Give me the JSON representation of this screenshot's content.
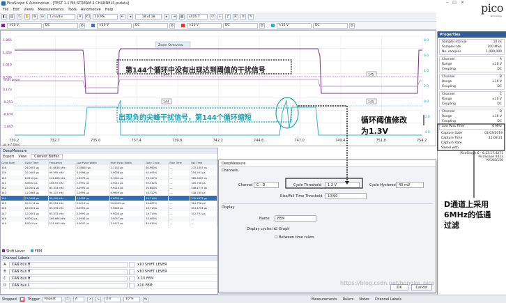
{
  "window": {
    "title": "PicoScope 6 Automotive - [TEST 1.1 MS STREAM 4 CHANNELS.psdata]",
    "controls": [
      "–",
      "□",
      "×"
    ]
  },
  "logo": {
    "text": "pico",
    "sub": "Technology"
  },
  "menu": [
    "File",
    "Edit",
    "Views",
    "Measurements",
    "Tools",
    "Automotive",
    "Help"
  ],
  "toolbar1": {
    "timebase": "1 ms/div",
    "samples": "10 MS",
    "page": "18 of 18",
    "zoom": "x416.7"
  },
  "toolbar2": {
    "channels": [
      {
        "range": "±10 V",
        "coupling": "DC",
        "color": "#7a2c8c"
      },
      {
        "range": "±10 V",
        "coupling": "DC",
        "color": "#3b6fcf"
      },
      {
        "range": "±10 V",
        "coupling": "DC",
        "color": "#d43c3c"
      },
      {
        "range": "±10 V",
        "coupling": "DC",
        "color": "#2bb5c4"
      }
    ]
  },
  "scope": {
    "y_labels_left": [
      "1.866",
      "1.443",
      "1.019",
      "0.596",
      "0.173",
      "-0.251",
      "-0.674",
      "-1.097"
    ],
    "y_labels_right": [
      "8.0",
      "6.0",
      "4.0",
      "2.0",
      "0.0",
      "-2.0",
      "-4.0"
    ],
    "x_ticks": [
      "730.2",
      "732.7",
      "735.0",
      "737.4",
      "739.8",
      "742.2",
      "744.6",
      "747.0",
      "749.4",
      "751.8",
      "754.2"
    ],
    "x_unit_left": "μs",
    "x_offset": "+7.0ms",
    "shift_lever": "Shift Lever",
    "fem_label": "FEM",
    "zoom_overview": "Zoom Overview",
    "markers": [
      "144",
      "145",
      "144",
      "145"
    ],
    "annotation1": "第144个循环中没有出现达到阈值的干扰信号",
    "annotation2": "出现负的尖峰干扰信号，第144个循环缩短"
  },
  "annotations": {
    "threshold": "循环阈值修改\n为1.3V",
    "lowpass": "D通道上采用\n6MHz的低通\n过滤",
    "watermark": "https://blog.csdn.net/hongke_pico"
  },
  "properties": {
    "title": "Properties",
    "general": [
      [
        "Sample interval",
        "10 ns"
      ],
      [
        "Sample rate",
        "100 MS/s"
      ],
      [
        "No. samples",
        "1,000,000"
      ]
    ],
    "channels": [
      {
        "rows": [
          [
            "Channel",
            "A"
          ],
          [
            "Range",
            "±10 V"
          ],
          [
            "Coupling",
            "DC"
          ]
        ]
      },
      {
        "rows": [
          [
            "Channel",
            "B"
          ],
          [
            "Range",
            "±10 V"
          ],
          [
            "Coupling",
            "DC"
          ]
        ]
      },
      {
        "rows": [
          [
            "Channel",
            "C"
          ],
          [
            "Range",
            "±10 V"
          ],
          [
            "Coupling",
            "DC"
          ]
        ]
      },
      {
        "rows": [
          [
            "Channel",
            "D"
          ],
          [
            "Range",
            "±10 V"
          ],
          [
            "Coupling",
            "DC"
          ],
          [
            "Low Pass Filter",
            "6 MHz"
          ]
        ]
      }
    ],
    "capture": [
      [
        "Capture Date",
        "01/03/2019"
      ],
      [
        "Capture Time",
        "12:08:21"
      ],
      [
        "Capture Rate",
        ""
      ],
      [
        "Saved with",
        ""
      ]
    ],
    "version": [
      "PicoScope 6 - 6.13.17.4271",
      "PicoScope 4423",
      "AV105/150"
    ]
  },
  "deepmeasure": {
    "title": "DeepMeasure",
    "tools": [
      "Export",
      "View",
      "Current Buffer"
    ],
    "columns": [
      "Cycle Num",
      "Cycle Time",
      "Frequency",
      "Low Pulse Width",
      "High Pulse Width",
      "Duty Cycle",
      "Rise Time",
      "Fall Time"
    ],
    "rows": [
      [
        "138",
        "24.0007 μs",
        "41.6616 kHz",
        "21.8805 μs",
        "2.1152 μs",
        "80.960%",
        "---",
        "272.1457 ns"
      ],
      [
        "139",
        "10.0005 μs",
        "99.995 kHz",
        "4.0998 μs",
        "5.9008 μs",
        "40.095%",
        "---",
        "254.591 μs"
      ],
      [
        "140",
        "8.0110 μs",
        "124.828 kHz",
        "1.4979 μs",
        "5.1001 μs",
        "75.147%",
        "---",
        "385.4629 ns"
      ],
      [
        "141",
        "6.0002 μs",
        "166.59 kHz",
        "2.0991 μs",
        "3.9011 μs",
        "50.332%",
        "---",
        "300.758 μs"
      ],
      [
        "142",
        "12.0001 μs",
        "83.333 kHz",
        "2.0991 μs",
        "9.9010 μs",
        "20.863%",
        "---",
        "548.4775 μs"
      ],
      [
        "143",
        "11.0664 μs",
        "90.337 kHz",
        "2.0993 μs",
        "8.9659 μs",
        "18.722%",
        "---",
        "538.785 μs"
      ],
      [
        "144",
        "11.0998 μs",
        "90.090 kHz",
        "2.0993 μs",
        "9.0005 μs",
        "18.719%",
        "---",
        "335.4873 μs"
      ],
      [
        "145",
        "12.0114 μs",
        "83.254 kHz",
        "2.0011 μs",
        "10.0099 μs",
        "16.667%",
        "---",
        "324.758 μs"
      ],
      [
        "146",
        "12.0001 μs",
        "83.333 kHz",
        "2.0991 μs",
        "9.9000 μs",
        "18.719%",
        "---",
        "314.4704 μs"
      ],
      [
        "147",
        "12.0001 μs",
        "83.333 kHz",
        "2.0991 μs",
        "9.9000 μs",
        "18.719%",
        "---",
        "312.791 μs"
      ],
      [
        "148",
        "6.0001 μs",
        "166.664 kHz",
        "2.0944 μs",
        "3.9057 μs",
        "33.465%",
        "---",
        "---"
      ],
      [
        "149",
        "8.0019 μs",
        "124.993 kHz",
        "4.0047 μs",
        "3.9972 μs",
        "49.935%",
        "---",
        "---"
      ]
    ],
    "selected_row": 6
  },
  "bottom_tabs": [
    "Shift Lever",
    "FEM"
  ],
  "channel_labels": {
    "title": "Channel Labels",
    "rows": [
      {
        "letter": "A",
        "source": "CAN bus H",
        "label": "x10 SHIFT LEVER"
      },
      {
        "letter": "B",
        "source": "CAN bus H",
        "label": "x10 SHIFT LEVER"
      },
      {
        "letter": "C",
        "source": "CAN bus H",
        "label": "X 10 FEM"
      },
      {
        "letter": "D",
        "source": "CAN bus L",
        "label": "X10 FEM"
      }
    ]
  },
  "dialog": {
    "title": "DeepMeasure",
    "channels_section": "Channels",
    "channel_label": "Channel",
    "channel_value": "C - D",
    "cycle_threshold_label": "Cycle Threshold",
    "cycle_threshold_value": "1.3 V",
    "cycle_hysteresis_label": "Cycle Hysteresis",
    "cycle_hysteresis_value": "40 mV",
    "rise_fall_label": "Rise/Fall Time Threshold",
    "rise_fall_value": "10/90",
    "display_section": "Display",
    "name_label": "Name",
    "name_value": "FEM",
    "display_cycles_label": "Display cycles in",
    "graph_option": "Graph",
    "between_rulers": "Between time rulers",
    "ok": "OK",
    "cancel": "Cancel"
  },
  "statusbar": {
    "state": "Stopped",
    "trigger_label": "Trigger",
    "trigger_mode": "Repeat",
    "channel": "A",
    "level": "3 V",
    "hysteresis": "10 %",
    "items": [
      "Measurements",
      "Rulers",
      "Notes",
      "Channel Labels"
    ]
  }
}
